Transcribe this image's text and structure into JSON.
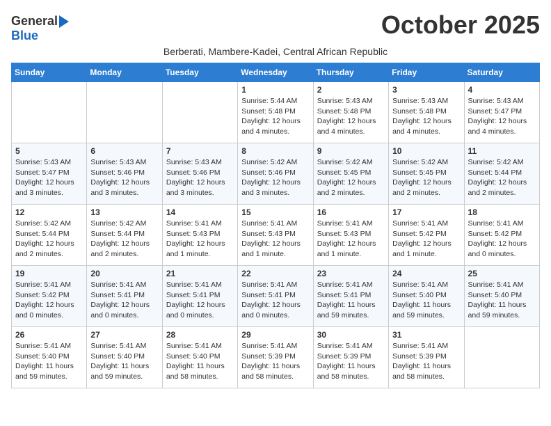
{
  "logo": {
    "general": "General",
    "blue": "Blue"
  },
  "header": {
    "month": "October 2025",
    "subtitle": "Berberati, Mambere-Kadei, Central African Republic"
  },
  "weekdays": [
    "Sunday",
    "Monday",
    "Tuesday",
    "Wednesday",
    "Thursday",
    "Friday",
    "Saturday"
  ],
  "weeks": [
    [
      {
        "day": "",
        "info": ""
      },
      {
        "day": "",
        "info": ""
      },
      {
        "day": "",
        "info": ""
      },
      {
        "day": "1",
        "info": "Sunrise: 5:44 AM\nSunset: 5:48 PM\nDaylight: 12 hours\nand 4 minutes."
      },
      {
        "day": "2",
        "info": "Sunrise: 5:43 AM\nSunset: 5:48 PM\nDaylight: 12 hours\nand 4 minutes."
      },
      {
        "day": "3",
        "info": "Sunrise: 5:43 AM\nSunset: 5:48 PM\nDaylight: 12 hours\nand 4 minutes."
      },
      {
        "day": "4",
        "info": "Sunrise: 5:43 AM\nSunset: 5:47 PM\nDaylight: 12 hours\nand 4 minutes."
      }
    ],
    [
      {
        "day": "5",
        "info": "Sunrise: 5:43 AM\nSunset: 5:47 PM\nDaylight: 12 hours\nand 3 minutes."
      },
      {
        "day": "6",
        "info": "Sunrise: 5:43 AM\nSunset: 5:46 PM\nDaylight: 12 hours\nand 3 minutes."
      },
      {
        "day": "7",
        "info": "Sunrise: 5:43 AM\nSunset: 5:46 PM\nDaylight: 12 hours\nand 3 minutes."
      },
      {
        "day": "8",
        "info": "Sunrise: 5:42 AM\nSunset: 5:46 PM\nDaylight: 12 hours\nand 3 minutes."
      },
      {
        "day": "9",
        "info": "Sunrise: 5:42 AM\nSunset: 5:45 PM\nDaylight: 12 hours\nand 2 minutes."
      },
      {
        "day": "10",
        "info": "Sunrise: 5:42 AM\nSunset: 5:45 PM\nDaylight: 12 hours\nand 2 minutes."
      },
      {
        "day": "11",
        "info": "Sunrise: 5:42 AM\nSunset: 5:44 PM\nDaylight: 12 hours\nand 2 minutes."
      }
    ],
    [
      {
        "day": "12",
        "info": "Sunrise: 5:42 AM\nSunset: 5:44 PM\nDaylight: 12 hours\nand 2 minutes."
      },
      {
        "day": "13",
        "info": "Sunrise: 5:42 AM\nSunset: 5:44 PM\nDaylight: 12 hours\nand 2 minutes."
      },
      {
        "day": "14",
        "info": "Sunrise: 5:41 AM\nSunset: 5:43 PM\nDaylight: 12 hours\nand 1 minute."
      },
      {
        "day": "15",
        "info": "Sunrise: 5:41 AM\nSunset: 5:43 PM\nDaylight: 12 hours\nand 1 minute."
      },
      {
        "day": "16",
        "info": "Sunrise: 5:41 AM\nSunset: 5:43 PM\nDaylight: 12 hours\nand 1 minute."
      },
      {
        "day": "17",
        "info": "Sunrise: 5:41 AM\nSunset: 5:42 PM\nDaylight: 12 hours\nand 1 minute."
      },
      {
        "day": "18",
        "info": "Sunrise: 5:41 AM\nSunset: 5:42 PM\nDaylight: 12 hours\nand 0 minutes."
      }
    ],
    [
      {
        "day": "19",
        "info": "Sunrise: 5:41 AM\nSunset: 5:42 PM\nDaylight: 12 hours\nand 0 minutes."
      },
      {
        "day": "20",
        "info": "Sunrise: 5:41 AM\nSunset: 5:41 PM\nDaylight: 12 hours\nand 0 minutes."
      },
      {
        "day": "21",
        "info": "Sunrise: 5:41 AM\nSunset: 5:41 PM\nDaylight: 12 hours\nand 0 minutes."
      },
      {
        "day": "22",
        "info": "Sunrise: 5:41 AM\nSunset: 5:41 PM\nDaylight: 12 hours\nand 0 minutes."
      },
      {
        "day": "23",
        "info": "Sunrise: 5:41 AM\nSunset: 5:41 PM\nDaylight: 11 hours\nand 59 minutes."
      },
      {
        "day": "24",
        "info": "Sunrise: 5:41 AM\nSunset: 5:40 PM\nDaylight: 11 hours\nand 59 minutes."
      },
      {
        "day": "25",
        "info": "Sunrise: 5:41 AM\nSunset: 5:40 PM\nDaylight: 11 hours\nand 59 minutes."
      }
    ],
    [
      {
        "day": "26",
        "info": "Sunrise: 5:41 AM\nSunset: 5:40 PM\nDaylight: 11 hours\nand 59 minutes."
      },
      {
        "day": "27",
        "info": "Sunrise: 5:41 AM\nSunset: 5:40 PM\nDaylight: 11 hours\nand 59 minutes."
      },
      {
        "day": "28",
        "info": "Sunrise: 5:41 AM\nSunset: 5:40 PM\nDaylight: 11 hours\nand 58 minutes."
      },
      {
        "day": "29",
        "info": "Sunrise: 5:41 AM\nSunset: 5:39 PM\nDaylight: 11 hours\nand 58 minutes."
      },
      {
        "day": "30",
        "info": "Sunrise: 5:41 AM\nSunset: 5:39 PM\nDaylight: 11 hours\nand 58 minutes."
      },
      {
        "day": "31",
        "info": "Sunrise: 5:41 AM\nSunset: 5:39 PM\nDaylight: 11 hours\nand 58 minutes."
      },
      {
        "day": "",
        "info": ""
      }
    ]
  ]
}
